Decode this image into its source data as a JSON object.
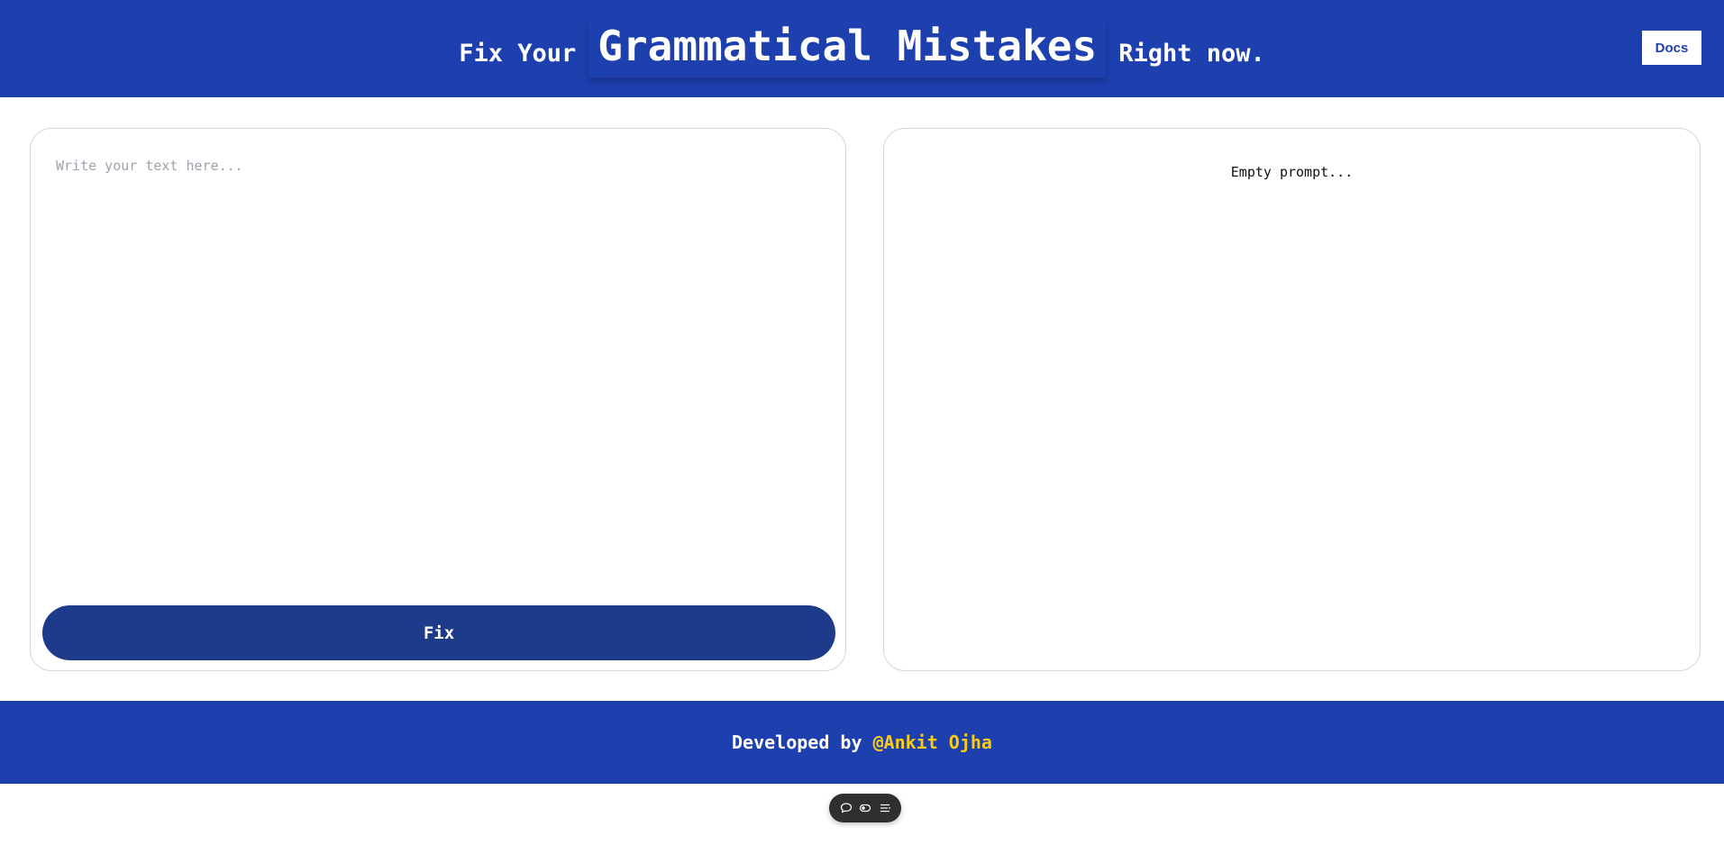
{
  "header": {
    "prefix": "Fix Your",
    "highlight": "Grammatical Mistakes",
    "suffix": "Right now.",
    "docs_label": "Docs"
  },
  "editor": {
    "placeholder": "Write your text here...",
    "value": "",
    "fix_label": "Fix"
  },
  "output": {
    "text": "Empty prompt..."
  },
  "footer": {
    "prefix": "Developed by",
    "author": "@Ankit Ojha"
  },
  "toolbar": {
    "icons": [
      "chat-icon",
      "toggle-icon",
      "list-icon"
    ]
  },
  "colors": {
    "primary": "#1e40af",
    "button": "#1e3a8a",
    "author_accent": "#facc15",
    "toolbar_bg": "#2f2f2f"
  }
}
